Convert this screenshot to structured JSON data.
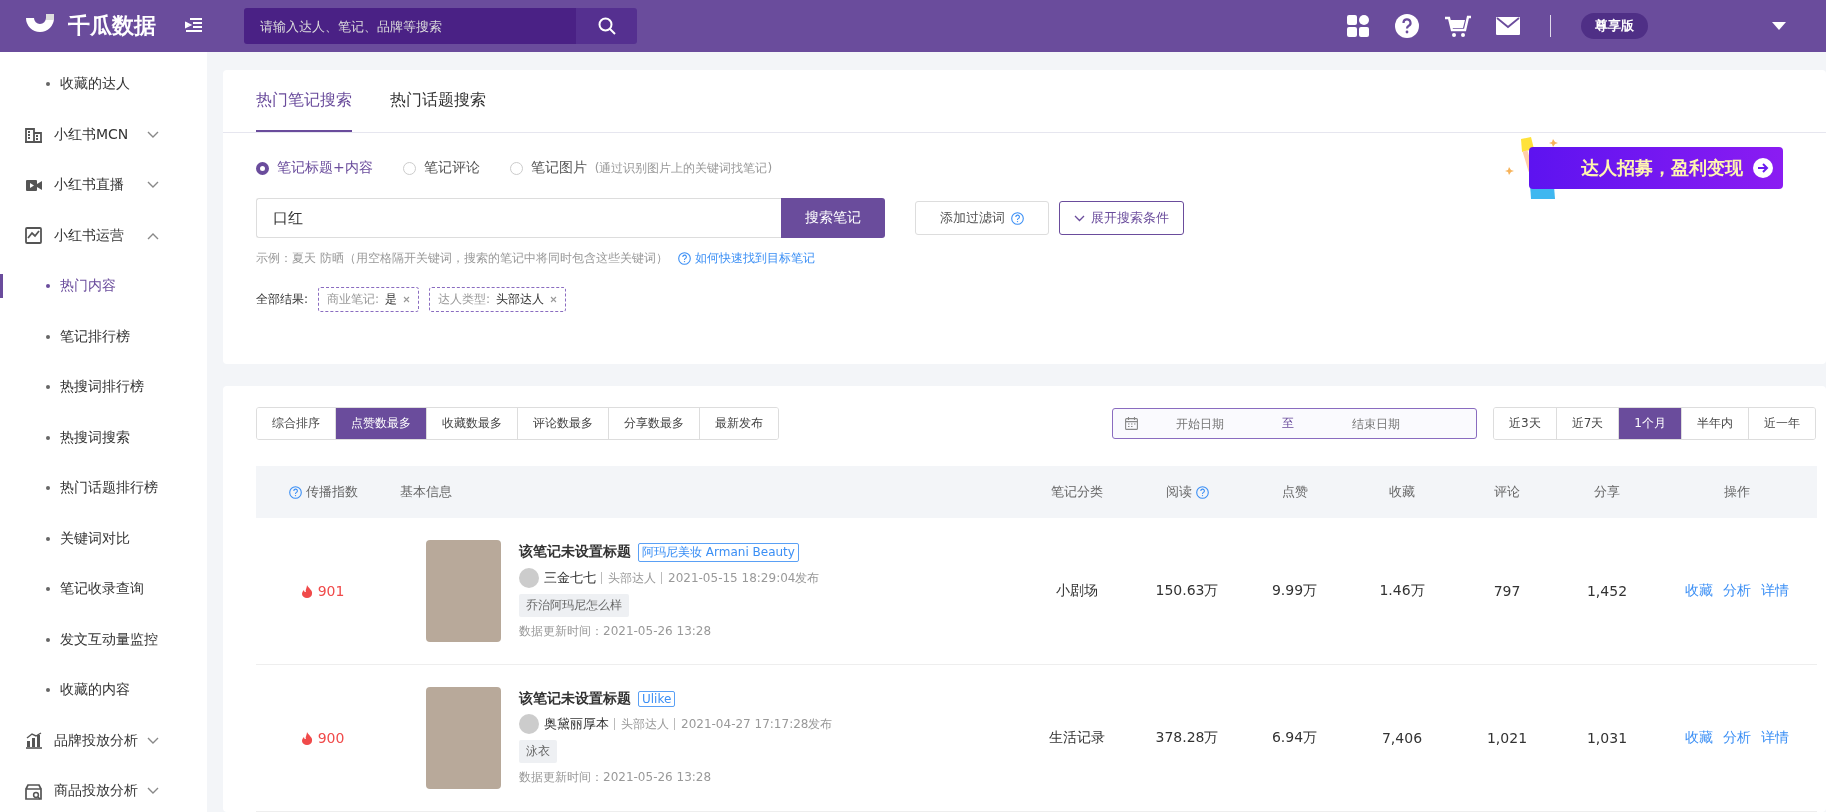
{
  "header": {
    "logo_text": "千瓜数据",
    "search": {
      "placeholder": "请输入达人、笔记、品牌等搜索"
    },
    "badge": "尊享版"
  },
  "sidebar": {
    "items": [
      {
        "kind": "link",
        "label": "收藏的达人",
        "selected": false
      },
      {
        "kind": "group",
        "label": "小红书MCN",
        "expanded": false
      },
      {
        "kind": "group",
        "label": "小红书直播",
        "expanded": false
      },
      {
        "kind": "group",
        "label": "小红书运营",
        "expanded": true,
        "children": [
          {
            "label": "热门内容",
            "selected": true
          },
          {
            "label": "笔记排行榜",
            "selected": false
          },
          {
            "label": "热搜词排行榜",
            "selected": false
          },
          {
            "label": "热搜词搜索",
            "selected": false
          },
          {
            "label": "热门话题排行榜",
            "selected": false
          },
          {
            "label": "关键词对比",
            "selected": false
          },
          {
            "label": "笔记收录查询",
            "selected": false
          },
          {
            "label": "发文互动量监控",
            "selected": false
          },
          {
            "label": "收藏的内容",
            "selected": false
          }
        ]
      },
      {
        "kind": "group",
        "label": "品牌投放分析",
        "expanded": false
      },
      {
        "kind": "group",
        "label": "商品投放分析",
        "expanded": false
      }
    ]
  },
  "search_panel": {
    "tabs": [
      {
        "label": "热门笔记搜索",
        "selected": true
      },
      {
        "label": "热门话题搜索",
        "selected": false
      }
    ],
    "modes": [
      {
        "label": "笔记标题+内容",
        "selected": true
      },
      {
        "label": "笔记评论",
        "selected": false
      },
      {
        "label": "笔记图片",
        "selected": false,
        "note": "(通过识别图片上的关键词找笔记)"
      }
    ],
    "banner": "达人招募，盈利变现",
    "query": "口红",
    "search_button": "搜索笔记",
    "filter_button": "添加过滤词",
    "expand_button": "展开搜索条件",
    "hint": "示例：夏天 防晒（用空格隔开关键词，搜索的笔记中将同时包含这些关键词）",
    "help_link": "如何快速找到目标笔记",
    "results_label": "全部结果:",
    "filters": [
      {
        "name": "商业笔记:",
        "value": "是"
      },
      {
        "name": "达人类型:",
        "value": "头部达人"
      }
    ]
  },
  "results": {
    "sort_buttons": [
      {
        "label": "综合排序",
        "selected": false
      },
      {
        "label": "点赞数最多",
        "selected": true
      },
      {
        "label": "收藏数最多",
        "selected": false
      },
      {
        "label": "评论数最多",
        "selected": false
      },
      {
        "label": "分享数最多",
        "selected": false
      },
      {
        "label": "最新发布",
        "selected": false
      }
    ],
    "date_range": {
      "start_placeholder": "开始日期",
      "separator": "至",
      "end_placeholder": "结束日期"
    },
    "periods": [
      {
        "label": "近3天",
        "selected": false
      },
      {
        "label": "近7天",
        "selected": false
      },
      {
        "label": "1个月",
        "selected": true
      },
      {
        "label": "半年内",
        "selected": false
      },
      {
        "label": "近一年",
        "selected": false
      }
    ],
    "table": {
      "columns": [
        {
          "label": "传播指数",
          "help_before": true
        },
        {
          "label": "基本信息"
        },
        {
          "label": "笔记分类"
        },
        {
          "label": "阅读",
          "help_after": true
        },
        {
          "label": "点赞"
        },
        {
          "label": "收藏"
        },
        {
          "label": "评论"
        },
        {
          "label": "分享"
        },
        {
          "label": "操作"
        }
      ],
      "rows": [
        {
          "index": "901",
          "title": "该笔记未设置标题",
          "brand": "阿玛尼美妆 Armani Beauty",
          "author": "三金七七",
          "author_type": "头部达人",
          "published": "2021-05-15 18:29:04发布",
          "topic": "乔治阿玛尼怎么样",
          "updated": "数据更新时间：2021-05-26 13:28",
          "category": "小剧场",
          "reads": "150.63万",
          "likes": "9.99万",
          "favorites": "1.46万",
          "comments": "797",
          "shares": "1,452",
          "actions": [
            "收藏",
            "分析",
            "详情"
          ]
        },
        {
          "index": "900",
          "title": "该笔记未设置标题",
          "brand": "Ulike",
          "author": "奥黛丽厚本",
          "author_type": "头部达人",
          "published": "2021-04-27 17:17:28发布",
          "topic": "泳衣",
          "updated": "数据更新时间：2021-05-26 13:28",
          "category": "生活记录",
          "reads": "378.28万",
          "likes": "6.94万",
          "favorites": "7,406",
          "comments": "1,021",
          "shares": "1,031",
          "actions": [
            "收藏",
            "分析",
            "详情"
          ]
        }
      ]
    }
  }
}
